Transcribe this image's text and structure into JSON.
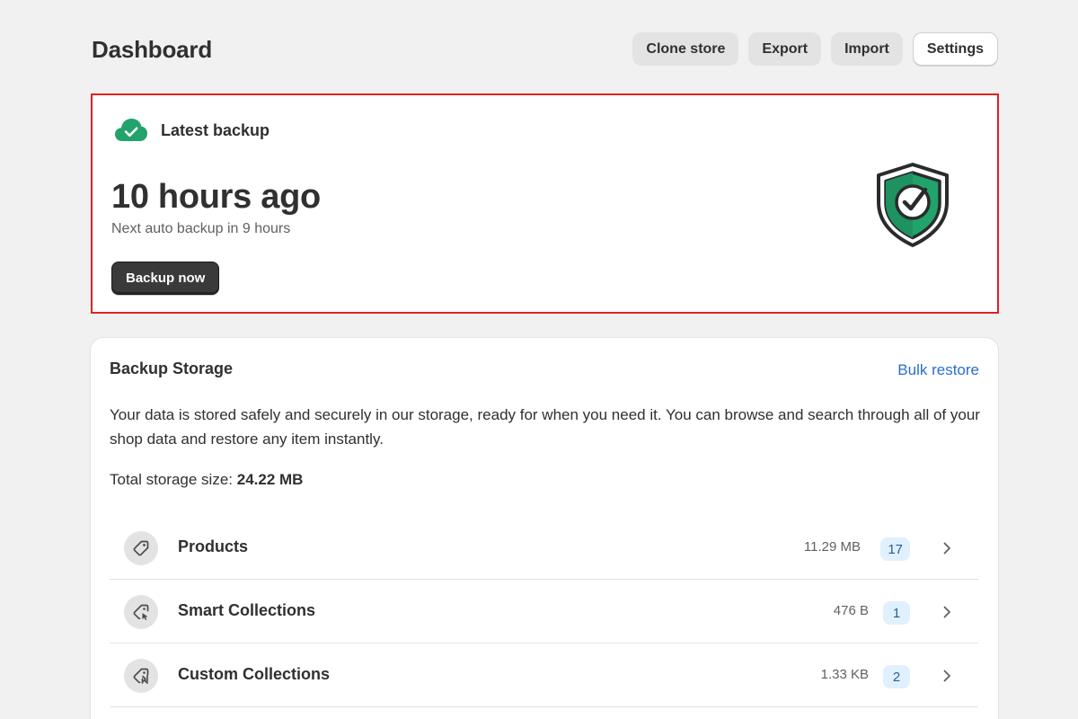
{
  "header": {
    "title": "Dashboard",
    "actions": [
      "Clone store",
      "Export",
      "Import",
      "Settings"
    ]
  },
  "latest_backup": {
    "icon": "cloud-check-icon",
    "title": "Latest backup",
    "time": "10 hours ago",
    "next": "Next auto backup in 9 hours",
    "button": "Backup now",
    "illustration": "shield-check-icon",
    "colors": {
      "accent": "#21a36b",
      "highlight_border": "#e52020"
    }
  },
  "storage": {
    "title": "Backup Storage",
    "bulk_restore": "Bulk restore",
    "description": "Your data is stored safely and securely in our storage, ready for when you need it. You can browse and search through all of your shop data and restore any item instantly.",
    "total_label": "Total storage size:",
    "total_value": "24.22 MB",
    "rows": [
      {
        "label": "Products",
        "size": "11.29 MB",
        "count": "17",
        "icon": "tag-icon"
      },
      {
        "label": "Smart Collections",
        "size": "476 B",
        "count": "1",
        "icon": "smart-collection-icon"
      },
      {
        "label": "Custom Collections",
        "size": "1.33 KB",
        "count": "2",
        "icon": "custom-collection-icon"
      }
    ]
  }
}
